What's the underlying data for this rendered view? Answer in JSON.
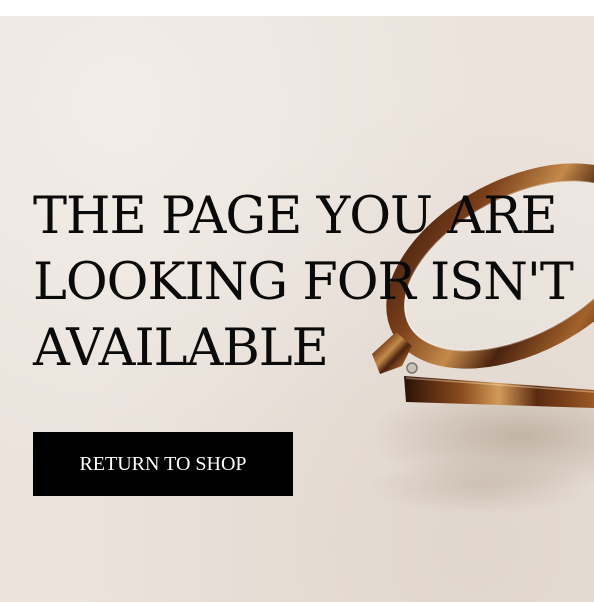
{
  "hero": {
    "headline_line1": "THE PAGE YOU ARE",
    "headline_line2": "LOOKING FOR ISN'T",
    "headline_line3": "AVAILABLE",
    "button_label": "RETURN TO SHOP",
    "background_color": "#ebe3dc",
    "button_color": "#000000",
    "image_subject": "tortoiseshell-glasses-image"
  }
}
